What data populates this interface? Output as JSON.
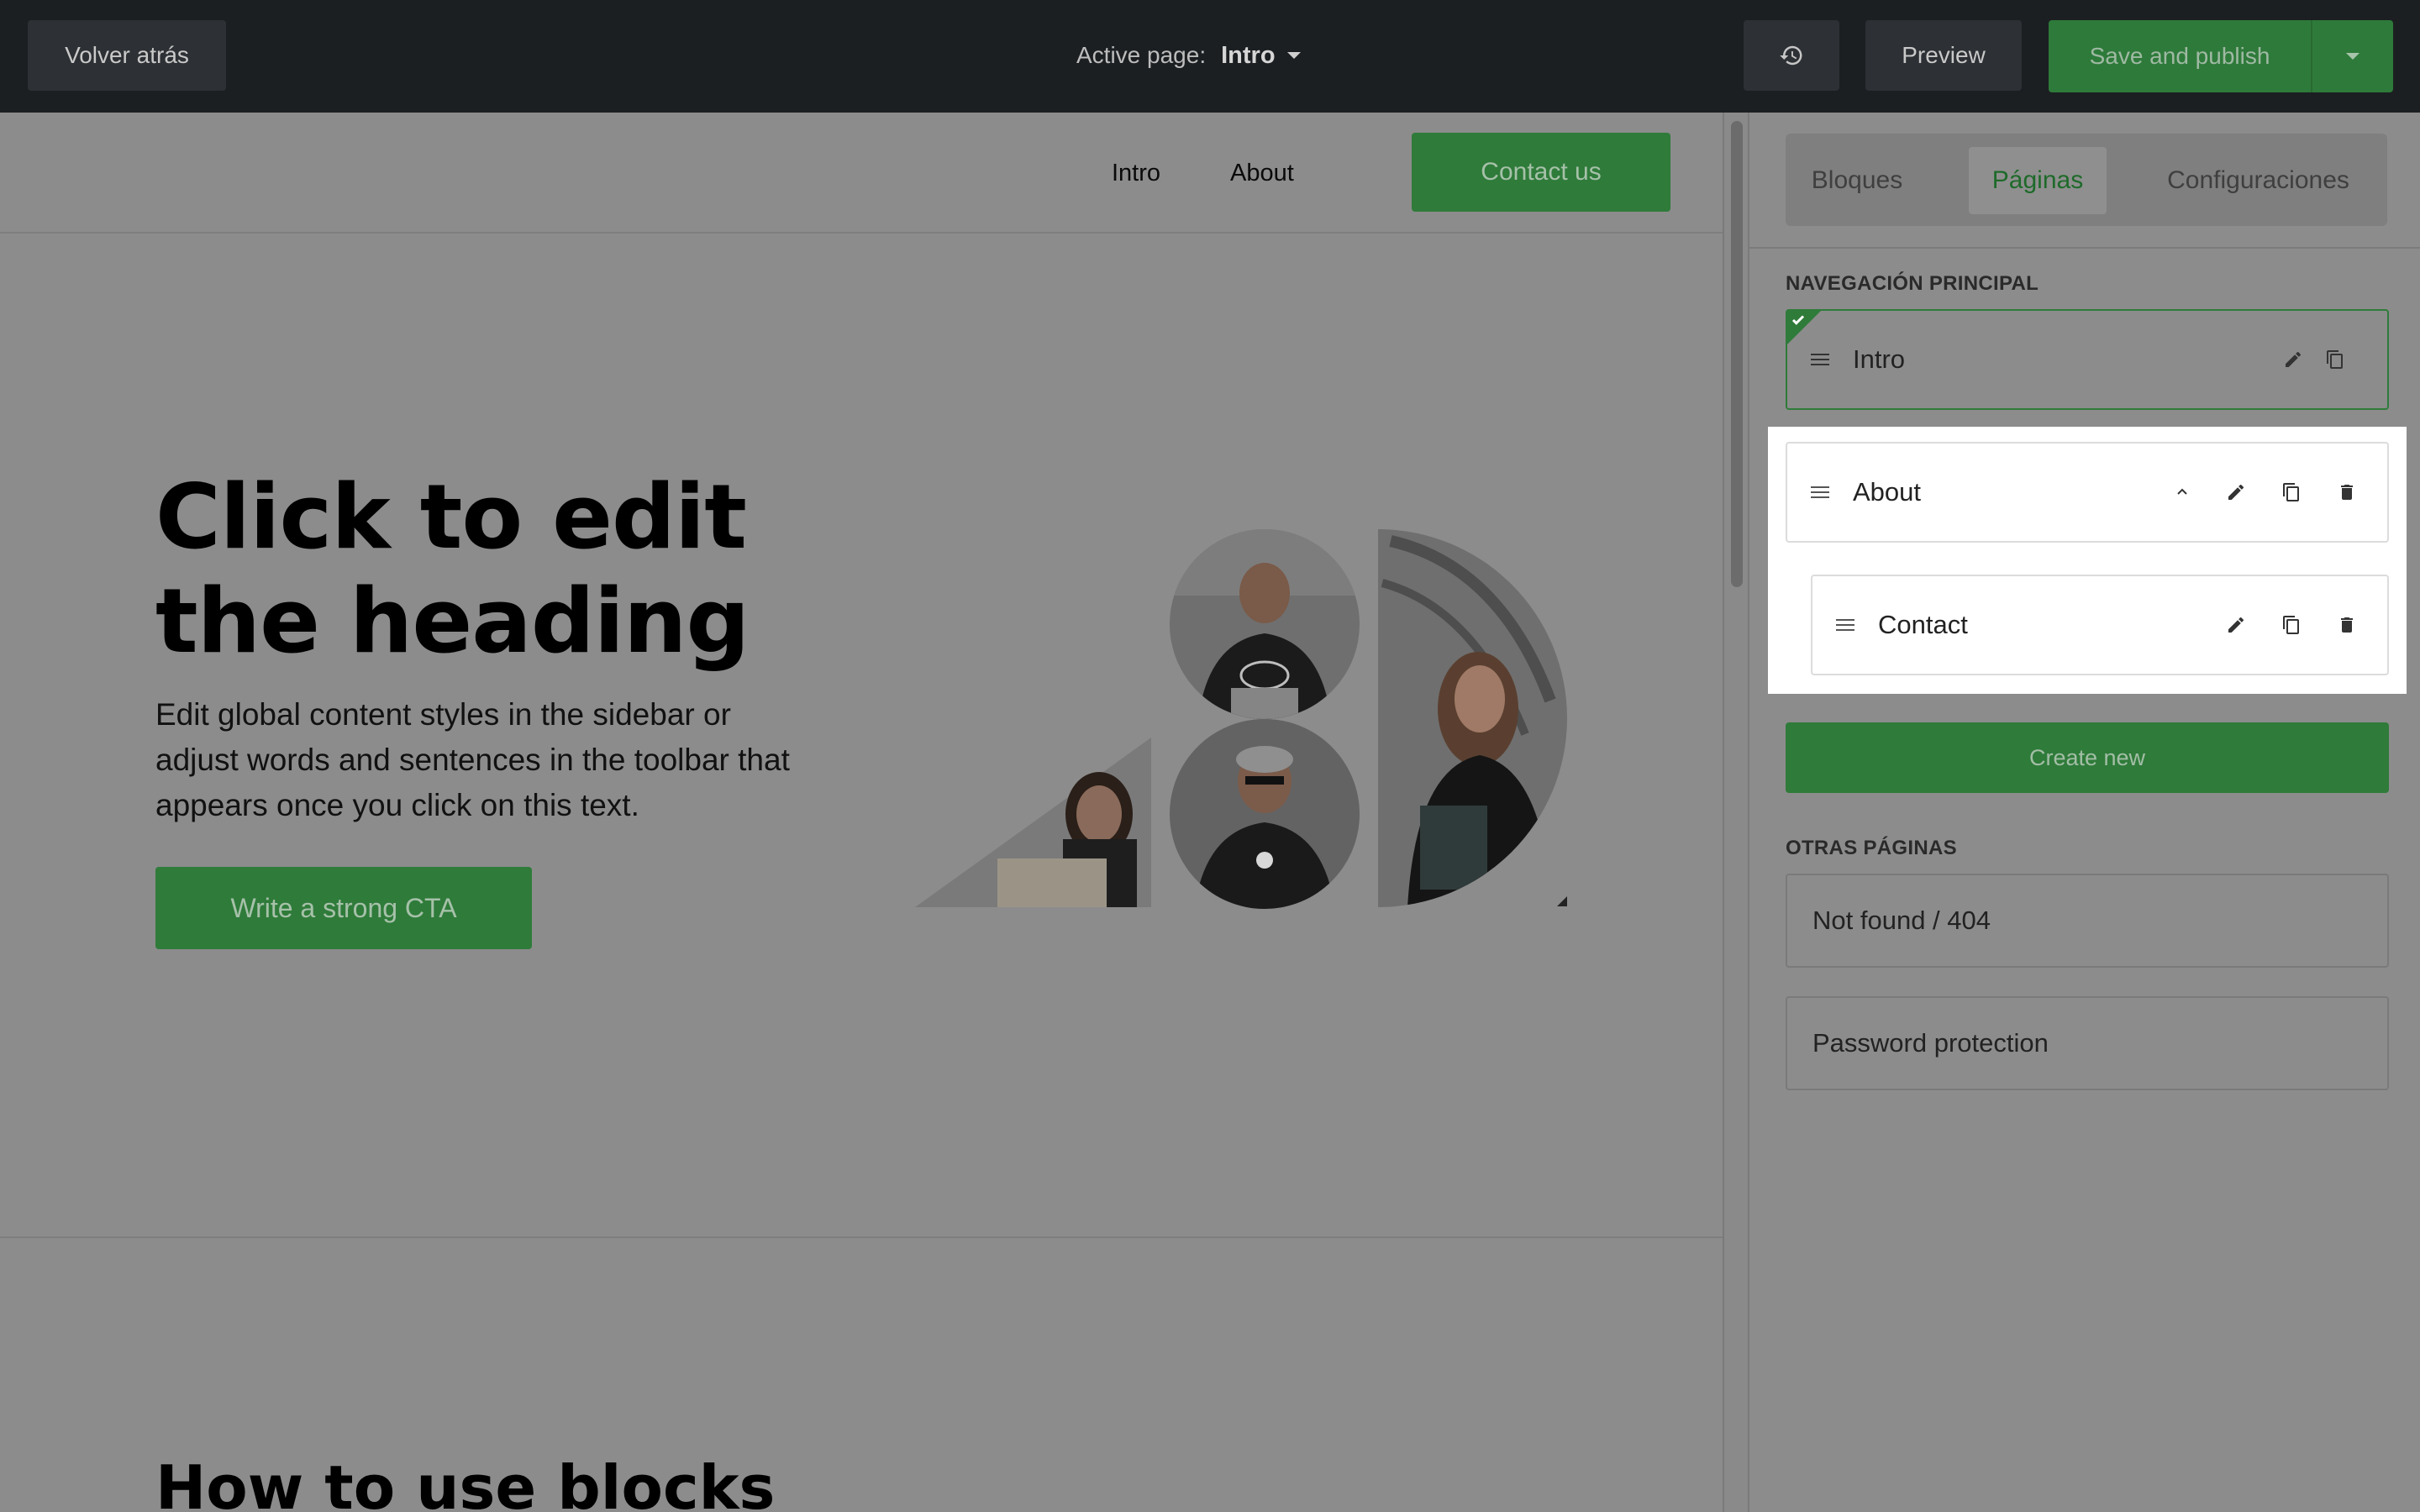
{
  "topbar": {
    "back_label": "Volver atrás",
    "active_page_label": "Active page:",
    "active_page_value": "Intro",
    "history_icon": "history-icon",
    "preview_label": "Preview",
    "publish_label": "Save and publish"
  },
  "site": {
    "nav_links": [
      "Intro",
      "About"
    ],
    "contact_label": "Contact us",
    "hero_heading": "Click to edit the heading",
    "hero_text": "Edit global content styles in the sidebar or adjust words and sentences in the toolbar that appears once you click on this text.",
    "cta_label": "Write a strong CTA",
    "section_heading": "How to use blocks"
  },
  "sidebar": {
    "tabs": [
      "Bloques",
      "Páginas",
      "Configuraciones"
    ],
    "active_tab": "Páginas",
    "main_nav_label": "NAVEGACIÓN PRINCIPAL",
    "main_pages": [
      {
        "label": "Intro",
        "home": true
      },
      {
        "label": "About",
        "expanded": true
      },
      {
        "label": "Contact",
        "child_of": "About"
      }
    ],
    "create_label": "Create new",
    "other_label": "OTRAS PÁGINAS",
    "other_pages": [
      "Not found / 404",
      "Password protection"
    ]
  },
  "colors": {
    "brand_green": "#2f7b3a",
    "topbar_bg": "#1c1f22",
    "overlay_gray": "#8c8c8c"
  }
}
